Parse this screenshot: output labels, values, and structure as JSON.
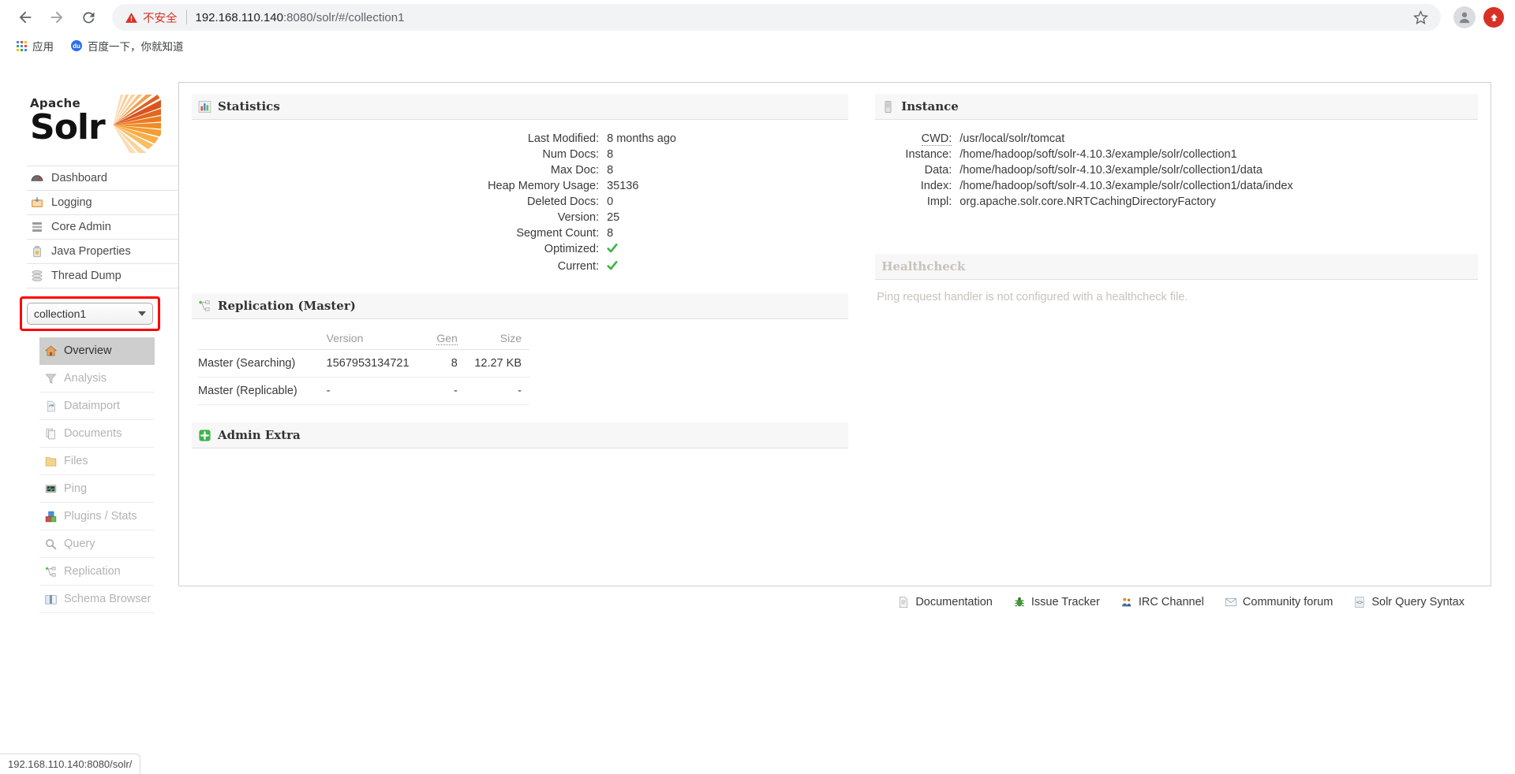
{
  "browser": {
    "back_icon": "back-arrow-icon",
    "forward_icon": "forward-arrow-icon",
    "reload_icon": "reload-icon",
    "security_label": "不安全",
    "url_host": "192.168.110.140",
    "url_rest": ":8080/solr/#/collection1",
    "star_icon": "bookmark-star-icon",
    "profile_icon": "profile-avatar-icon",
    "update_icon": "update-arrow-icon",
    "bookmarks": [
      {
        "label": "应用",
        "icon": "apps-grid-icon"
      },
      {
        "label": "百度一下，你就知道",
        "icon": "baidu-icon"
      }
    ]
  },
  "status_bar": {
    "text": "192.168.110.140:8080/solr/"
  },
  "sidebar": {
    "logo": {
      "apache": "Apache",
      "solr": "Solr"
    },
    "nav": [
      {
        "label": "Dashboard",
        "icon": "dashboard-gauge-icon"
      },
      {
        "label": "Logging",
        "icon": "logging-tray-icon"
      },
      {
        "label": "Core Admin",
        "icon": "core-admin-database-icon"
      },
      {
        "label": "Java Properties",
        "icon": "java-properties-jar-icon"
      },
      {
        "label": "Thread Dump",
        "icon": "thread-dump-stack-icon"
      }
    ],
    "collection": {
      "value": "collection1",
      "caret_icon": "chevron-down-icon"
    },
    "subnav": [
      {
        "label": "Overview",
        "icon": "home-icon",
        "active": true
      },
      {
        "label": "Analysis",
        "icon": "funnel-icon",
        "active": false
      },
      {
        "label": "Dataimport",
        "icon": "dataimport-icon",
        "active": false
      },
      {
        "label": "Documents",
        "icon": "documents-icon",
        "active": false
      },
      {
        "label": "Files",
        "icon": "folder-icon",
        "active": false
      },
      {
        "label": "Ping",
        "icon": "ping-monitor-icon",
        "active": false
      },
      {
        "label": "Plugins / Stats",
        "icon": "plugins-blocks-icon",
        "active": false
      },
      {
        "label": "Query",
        "icon": "magnifier-icon",
        "active": false
      },
      {
        "label": "Replication",
        "icon": "replication-nodes-icon",
        "active": false
      },
      {
        "label": "Schema Browser",
        "icon": "book-icon",
        "active": false
      }
    ]
  },
  "statistics": {
    "title": "Statistics",
    "icon": "bar-chart-icon",
    "rows": [
      {
        "key": "Last Modified:",
        "value": "8 months ago"
      },
      {
        "key": "Num Docs:",
        "value": "8"
      },
      {
        "key": "Max Doc:",
        "value": "8"
      },
      {
        "key": "Heap Memory Usage:",
        "value": "35136"
      },
      {
        "key": "Deleted Docs:",
        "value": "0"
      },
      {
        "key": "Version:",
        "value": "25"
      },
      {
        "key": "Segment Count:",
        "value": "8"
      }
    ],
    "flags": [
      {
        "key": "Optimized:",
        "value": "✔",
        "icon": "green-check-icon"
      },
      {
        "key": "Current:",
        "value": "✔",
        "icon": "green-check-icon"
      }
    ]
  },
  "replication": {
    "title": "Replication (Master)",
    "icon": "replication-nodes-icon",
    "columns": [
      "",
      "Version",
      "Gen",
      "Size"
    ],
    "rows": [
      {
        "label": "Master (Searching)",
        "version": "1567953134721",
        "gen": "8",
        "size": "12.27 KB"
      },
      {
        "label": "Master (Replicable)",
        "version": "-",
        "gen": "-",
        "size": "-"
      }
    ]
  },
  "admin_extra": {
    "title": "Admin Extra",
    "icon": "green-plus-icon"
  },
  "instance": {
    "title": "Instance",
    "icon": "instance-server-icon",
    "rows": [
      {
        "key": "CWD:",
        "value": "/usr/local/solr/tomcat",
        "abbr": true
      },
      {
        "key": "Instance:",
        "value": "/home/hadoop/soft/solr-4.10.3/example/solr/collection1",
        "abbr": false
      },
      {
        "key": "Data:",
        "value": "/home/hadoop/soft/solr-4.10.3/example/solr/collection1/data",
        "abbr": false
      },
      {
        "key": "Index:",
        "value": "/home/hadoop/soft/solr-4.10.3/example/solr/collection1/data/index",
        "abbr": false
      }
    ],
    "impl": {
      "key": "Impl:",
      "value": "org.apache.solr.core.NRTCachingDirectoryFactory"
    }
  },
  "healthcheck": {
    "title": "Healthcheck",
    "message": "Ping request handler is not configured with a healthcheck file."
  },
  "footer_links": [
    {
      "label": "Documentation",
      "icon": "document-icon"
    },
    {
      "label": "Issue Tracker",
      "icon": "bug-icon"
    },
    {
      "label": "IRC Channel",
      "icon": "people-icon"
    },
    {
      "label": "Community forum",
      "icon": "envelope-icon"
    },
    {
      "label": "Solr Query Syntax",
      "icon": "code-icon"
    }
  ],
  "colors": {
    "accent_orange": "#d9541e",
    "warning_red": "#d93025",
    "highlight_red": "#ff0000",
    "check_green": "#3ab54a",
    "muted_grey": "#b3b3b3"
  }
}
